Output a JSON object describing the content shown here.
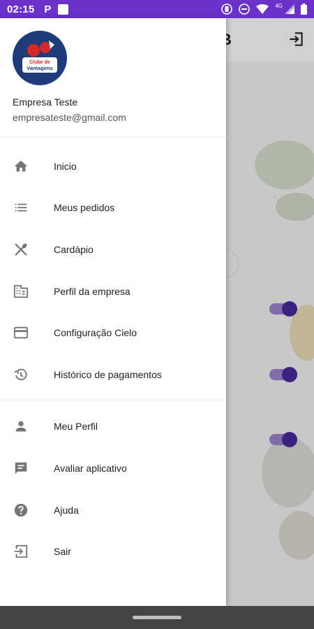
{
  "status_bar": {
    "time": "02:15",
    "app_letter": "P",
    "network": "4G"
  },
  "app": {
    "title_fragment": "B",
    "toggles_on": [
      true,
      true,
      true
    ]
  },
  "drawer": {
    "user": {
      "name": "Empresa Teste",
      "email": "empresateste@gmail.com"
    },
    "logo": {
      "text_top": "Clube de",
      "text_bottom": "Vantagens"
    },
    "menu": [
      {
        "label": "Inicio",
        "icon": "home-icon"
      },
      {
        "label": "Meus pedidos",
        "icon": "list-icon"
      },
      {
        "label": "Cardápio",
        "icon": "utensils-icon"
      },
      {
        "label": "Perfil da empresa",
        "icon": "business-icon"
      },
      {
        "label": "Configuração Cielo",
        "icon": "credit-card-icon"
      },
      {
        "label": "Histórico de pagamentos",
        "icon": "history-icon"
      }
    ],
    "secondary_menu": [
      {
        "label": "Meu Perfil",
        "icon": "person-icon"
      },
      {
        "label": "Avaliar aplicativo",
        "icon": "feedback-icon"
      },
      {
        "label": "Ajuda",
        "icon": "help-icon"
      },
      {
        "label": "Sair",
        "icon": "exit-icon"
      }
    ]
  },
  "colors": {
    "status_bar": "#6a32c8",
    "toggle_knob": "#4a2a9c",
    "icon_gray": "#757575"
  }
}
